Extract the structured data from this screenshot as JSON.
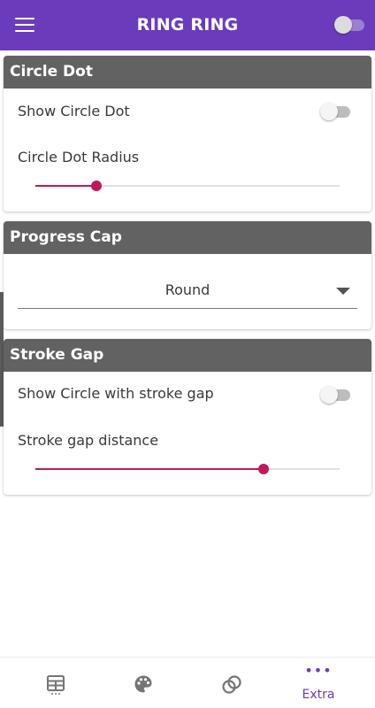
{
  "app_bar": {
    "title": "RING RING",
    "menu_icon": "hamburger-menu-icon",
    "toggle_on": false
  },
  "colors": {
    "primary": "#6a3cbc",
    "card_header": "#626262",
    "accent": "#c2185b"
  },
  "circle_dot": {
    "header": "Circle Dot",
    "show_label": "Show Circle Dot",
    "show_on": false,
    "radius_label": "Circle Dot Radius",
    "radius_fraction": 0.2
  },
  "progress_cap": {
    "header": "Progress Cap",
    "selected": "Round"
  },
  "stroke_gap": {
    "header": "Stroke Gap",
    "show_label": "Show Circle with stroke gap",
    "show_on": false,
    "distance_label": "Stroke gap distance",
    "distance_fraction": 0.75
  },
  "bottom_nav": {
    "items": [
      {
        "icon": "table-grid-icon",
        "label": ""
      },
      {
        "icon": "palette-icon",
        "label": ""
      },
      {
        "icon": "rings-icon",
        "label": ""
      },
      {
        "icon": "more-dots-icon",
        "label": "Extra",
        "dots": "•••"
      }
    ]
  }
}
